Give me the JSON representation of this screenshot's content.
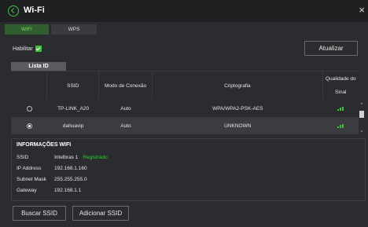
{
  "window": {
    "title": "Wi-Fi"
  },
  "tabs": [
    {
      "label": "WIFI"
    },
    {
      "label": "WPS"
    }
  ],
  "enable": {
    "label": "Habilitar",
    "checked": true
  },
  "buttons": {
    "update": "Atualizar",
    "search": "Buscar SSID",
    "add": "Adicionar SSID"
  },
  "list": {
    "tab_label": "Lista ID",
    "columns": [
      "",
      "SSID",
      "Modo de Conexão",
      "Criptografia",
      "Qualidade do Sinal"
    ],
    "columns_quality_line1": "Qualidade do",
    "columns_quality_line2": "Sinal",
    "rows": [
      {
        "ssid": "TP-LINK_A20",
        "mode": "Auto",
        "crypto": "WPA/WPA2-PSK-AES",
        "selected": false
      },
      {
        "ssid": "dahuavip",
        "mode": "Auto",
        "crypto": "UNKNOWN",
        "selected": true
      }
    ]
  },
  "info": {
    "title": "INFORMAÇÕES WIFI",
    "ssid_label": "SSID",
    "ssid_value": "Intelbras 1",
    "ssid_status": "Registrado",
    "ip_label": "IP Address",
    "ip_value": "192.168.1.160",
    "mask_label": "Subnet Mask",
    "mask_value": "255.255.255.0",
    "gw_label": "Gateway",
    "gw_value": "192.168.1.1"
  },
  "colors": {
    "accent": "#3fbf3f",
    "background": "#2b2c2f"
  }
}
